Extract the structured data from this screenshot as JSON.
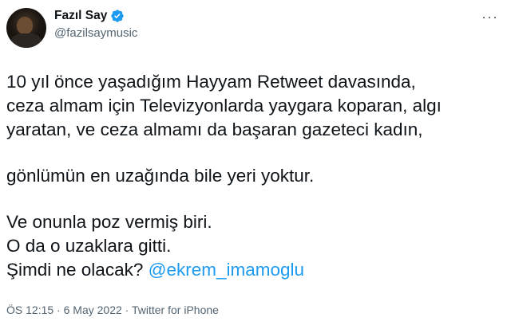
{
  "tweet": {
    "author": {
      "display_name": "Fazıl Say",
      "handle": "@fazilsaymusic",
      "verified": true,
      "verified_color": "#1d9bf0"
    },
    "more_label": "···",
    "lines": [
      "10 yıl önce yaşadığım Hayyam Retweet davasında,",
      "ceza almam için Televizyonlarda yaygara koparan, algı",
      "yaratan, ve ceza almamı da başaran gazeteci kadın,",
      "gönlümün en uzağında bile yeri yoktur.",
      "Ve onunla poz vermiş biri.",
      "O da o uzaklara gitti.",
      "Şimdi ne olacak? "
    ],
    "mention": "@ekrem_imamoglu",
    "meta": {
      "time": "ÖS 12:15",
      "separator": " · ",
      "date": "6 May 2022",
      "source": "Twitter for iPhone"
    },
    "icons": {
      "verified": "verified-badge-icon",
      "more": "more-options-icon"
    },
    "colors": {
      "text": "#0f1419",
      "secondary": "#536471",
      "link": "#1d9bf0"
    }
  }
}
